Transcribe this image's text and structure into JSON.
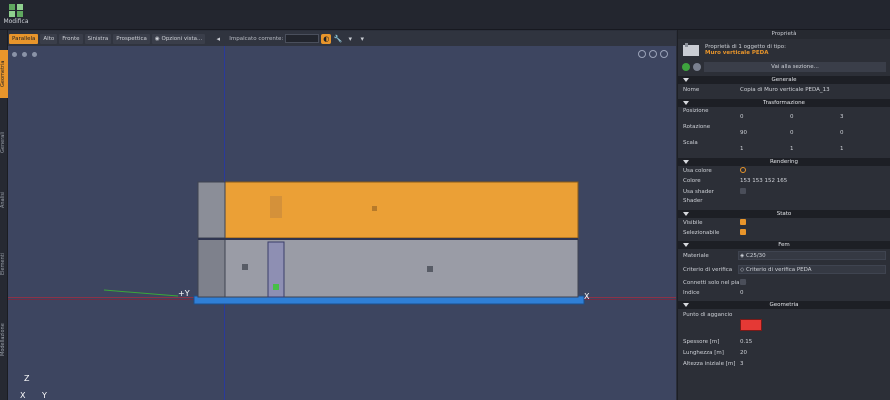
{
  "topbar": {
    "modifica_label": "Modifica"
  },
  "sidebar_tabs": [
    "Geometria",
    "Generali",
    "Analisi",
    "Elementi",
    "Modellazione"
  ],
  "toolbar": {
    "view_buttons": [
      "Parallela",
      "Alto",
      "Fronte",
      "Sinistra",
      "Prospettica"
    ],
    "options_label": "Opzioni vista...",
    "plane_label": "Impalcato corrente:"
  },
  "viewport": {
    "axis_y_label": "+Y",
    "axis_x_label": "X",
    "axis_z_label": "Z",
    "axis_x2_label": "X",
    "axis_y2_label": "Y"
  },
  "properties": {
    "header": "Proprietà",
    "info_line1": "Proprietà di 1 oggetto di tipo:",
    "object_type": "Muro verticale PEDA",
    "goto_section": "Vai alla sezione...",
    "sections": {
      "generale": "Generale",
      "trasformazione": "Trasformazione",
      "rendering": "Rendering",
      "stato": "Stato",
      "fem": "Fem",
      "geometria": "Geometria"
    },
    "fields": {
      "nome_label": "Nome",
      "nome_value": "Copia di Muro verticale PEDA_13",
      "posizione_label": "Posizione",
      "posizione": [
        "0",
        "0",
        "3"
      ],
      "rotazione_label": "Rotazione",
      "rotazione": [
        "90",
        "0",
        "0"
      ],
      "scala_label": "Scala",
      "scala": [
        "1",
        "1",
        "1"
      ],
      "usa_colore_label": "Usa colore",
      "colore_label": "Colore",
      "colore_value": "153 153 152 165",
      "usa_shader_label": "Usa shader",
      "shader_label": "Shader",
      "visibile_label": "Visibile",
      "selezionabile_label": "Selezionabile",
      "materiale_label": "Materiale",
      "materiale_value": "C25/30",
      "criterio_label": "Criterio di verifica",
      "criterio_value": "Criterio di verifica PEDA",
      "connetti_label": "Connetti solo nel piano",
      "indice_label": "Indice",
      "indice_value": "0",
      "punto_label": "Punto di aggancio",
      "spessore_label": "Spessore [m]",
      "spessore_value": "0.15",
      "lunghezza_label": "Lunghezza [m]",
      "lunghezza_value": "20",
      "altezza_label": "Altezza iniziale [m]",
      "altezza_value": "3"
    }
  },
  "colors": {
    "accent": "#e8952b",
    "viewport_bg": "#3d4560",
    "wall_top": "#eba036",
    "wall_bottom": "#9a9ca6",
    "base": "#2f7fd6"
  }
}
